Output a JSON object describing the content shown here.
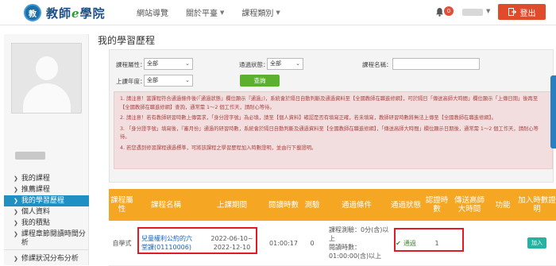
{
  "header": {
    "logo_mark": "教",
    "logo_text_a": "教師",
    "logo_text_e": "e",
    "logo_text_b": "學院",
    "nav": [
      "網站導覽",
      "關於平臺",
      "課程類別"
    ],
    "notification_count": "0",
    "logout_label": "登出"
  },
  "page_title": "我的學習歷程",
  "sidebar": {
    "items": [
      {
        "label": "我的課程"
      },
      {
        "label": "推薦課程"
      },
      {
        "label": "我的學習歷程"
      },
      {
        "label": "個人資料"
      },
      {
        "label": "我的積點"
      },
      {
        "label": "課程章節閱讀時間分析"
      },
      {
        "label": "修課狀況分布分析"
      }
    ]
  },
  "filters": {
    "course_attr_label": "課程屬性：",
    "course_attr_value": "全部",
    "pass_status_label": "通過狀態：",
    "pass_status_value": "全部",
    "course_name_label": "課程名稱：",
    "course_name_value": "",
    "year_label": "上課年度：",
    "year_value": "全部",
    "query_label": "查詢"
  },
  "notice": [
    "1. 請注意！當課程符合通過條件後(「通過狀態」欄位顯示『通過』)，系統會於隔日自動判斷及通過資料至【全國教師在職進修網】，可於隔日「傳送高師大時間」欄位顯示「上傳日期」後再至【全國教師在職進修網】查詢，通常需 1～2 個工作天，請耐心等待。",
    "2. 請注意！若有教師研習時數上傳需求，「身分證字號」為必填，請至【個人資料】確認是否有填寫正確，若未填寫，教師研習時數將無法上傳至【全國教師在職進修網】。",
    "3. 「身分證字號」填寫後，『審月份』通過的研習時數，系統會於隔日自動判斷及通過資料至【全國教師在職進修網】，「傳送高師大時間」欄位顯示日期後，通常需 1～2 個工作天，請耐心等待。",
    "4. 若您遇到修習課程通過標準，可將該課程之學習歷程加入時數證明，並由行下載證明。"
  ],
  "table": {
    "headers": [
      "課程屬性",
      "課程名稱",
      "上課期間",
      "閱讀時數",
      "測驗",
      "通過條件",
      "通過狀態",
      "認證時數",
      "傳送高師大時間",
      "功能",
      "加入時數證明"
    ],
    "rows": [
      {
        "attr": "自學式",
        "name": "兒童權利公約的六堂課(01110006)",
        "period_start": "2022-06-10~",
        "period_end": "2022-12-10",
        "read_time": "01:00:17",
        "test": "0",
        "cond_a": "課程測驗：0分(含)以上",
        "cond_b": "閱讀時數：01:00:00(含)以上",
        "status": "通過",
        "hours": "1",
        "sent_time": "",
        "function": "",
        "add_label": "加入"
      }
    ]
  }
}
